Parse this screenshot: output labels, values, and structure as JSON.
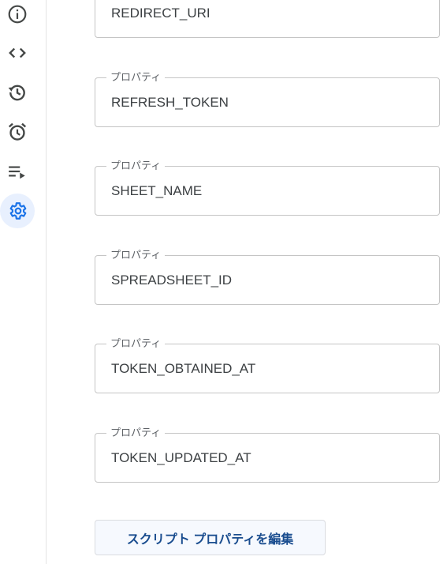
{
  "sidebar": {
    "items": [
      {
        "icon": "info-icon",
        "active": false
      },
      {
        "icon": "code-icon",
        "active": false
      },
      {
        "icon": "history-icon",
        "active": false
      },
      {
        "icon": "alarm-clock-icon",
        "active": false
      },
      {
        "icon": "executions-icon",
        "active": false
      },
      {
        "icon": "gear-icon",
        "active": true
      }
    ],
    "accent_color": "#1a73e8",
    "icon_color": "#444746"
  },
  "properties": {
    "items": [
      {
        "label": "",
        "value": "REDIRECT_URI"
      },
      {
        "label": "プロパティ",
        "value": "REFRESH_TOKEN"
      },
      {
        "label": "プロパティ",
        "value": "SHEET_NAME"
      },
      {
        "label": "プロパティ",
        "value": "SPREADSHEET_ID"
      },
      {
        "label": "プロパティ",
        "value": "TOKEN_OBTAINED_AT"
      },
      {
        "label": "プロパティ",
        "value": "TOKEN_UPDATED_AT"
      }
    ]
  },
  "actions": {
    "edit_button_label": "スクリプト プロパティを編集"
  }
}
